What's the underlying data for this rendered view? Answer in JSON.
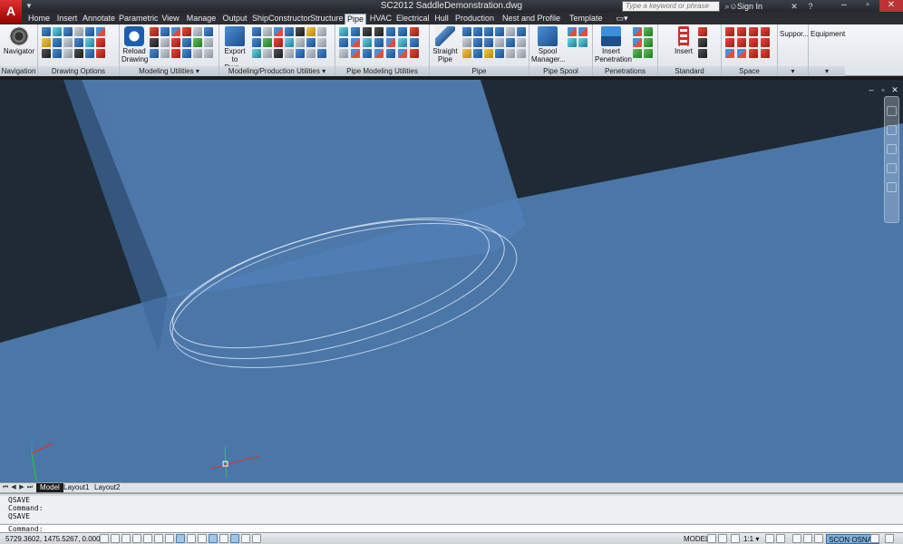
{
  "titlebar": {
    "app_logo": "A",
    "title": "SC2012    SaddleDemonstration.dwg",
    "search_placeholder": "Type a keyword or phrase",
    "sign_in": "Sign In"
  },
  "tabs": [
    "Home",
    "Insert",
    "Annotate",
    "Parametric",
    "View",
    "Manage",
    "Output",
    "ShipConstructor",
    "Structure",
    "Pipe",
    "HVAC",
    "Electrical",
    "Hull",
    "Production",
    "Nest and Profile Plots",
    "Template"
  ],
  "active_tab": "Pipe",
  "ribbon": {
    "navigation": {
      "title": "Navigation",
      "button": "Navigator"
    },
    "drawing_options": {
      "title": "Drawing Options"
    },
    "modeling_utilities": {
      "title": "Modeling Utilities ▾",
      "button": "Reload Drawing"
    },
    "modeling_production": {
      "title": "Modeling/Production Utilities ▾",
      "button": "Export to Dwg..."
    },
    "pipe_modeling": {
      "title": "Pipe Modeling Utilities"
    },
    "pipe": {
      "title": "Pipe",
      "button": "Straight Pipe"
    },
    "pipe_spool": {
      "title": "Pipe Spool",
      "button": "Spool Manager..."
    },
    "penetrations": {
      "title": "Penetrations",
      "button": "Insert Penetration"
    },
    "standard_assemblies": {
      "title": "Standard Assemblies",
      "button": "Insert"
    },
    "space_allocations": {
      "title": "Space Allocations"
    },
    "supports": {
      "title": "Suppor..."
    },
    "equipment": {
      "title": "Equipment"
    }
  },
  "layout_tabs": [
    "Model",
    "Layout1",
    "Layout2"
  ],
  "active_layout": "Model",
  "command": {
    "history": [
      "QSAVE",
      "Command:",
      "QSAVE"
    ],
    "prompt": "Command:"
  },
  "status": {
    "coords": "5729.3602, 1475.5267, 0.0000",
    "model": "MODEL",
    "scale": "1:1 ▾",
    "scon_osnap": "SCON OSNAP"
  },
  "colors": {
    "viewport_dark": "#233647",
    "model_blue": "#4a76a8",
    "accent_red": "#c8302a"
  }
}
